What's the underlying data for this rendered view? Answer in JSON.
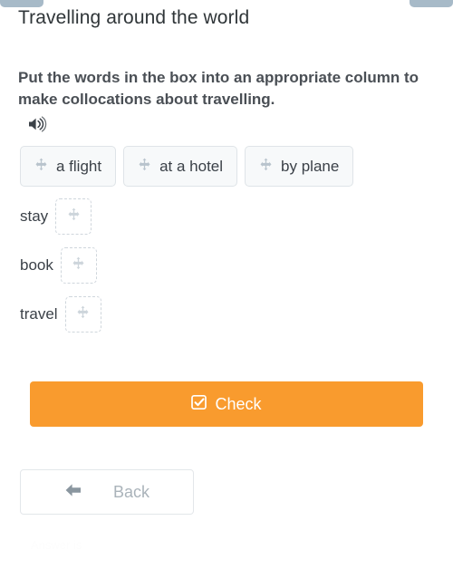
{
  "colors": {
    "accent_orange": "#f99b2e",
    "top_tab": "#a7bac8",
    "chip_bg": "#f7f9fa",
    "chip_border": "#dfe4e8",
    "drop_border": "#cfd6dc",
    "text_dark": "#3b4148",
    "text_muted": "#aab3ba"
  },
  "header": {
    "title": "Travelling around the world"
  },
  "task": {
    "instruction": "Put the words in the box into an appropriate column to make collocations about travelling.",
    "audio_icon": "volume-up-icon"
  },
  "word_bank": {
    "move_icon": "arrows-move-icon",
    "chips": [
      {
        "label": "a flight"
      },
      {
        "label": "at a hotel"
      },
      {
        "label": "by plane"
      }
    ]
  },
  "collocations": {
    "drop_icon": "arrows-move-icon",
    "rows": [
      {
        "label": "stay",
        "value": ""
      },
      {
        "label": "book",
        "value": ""
      },
      {
        "label": "travel",
        "value": ""
      }
    ]
  },
  "actions": {
    "check_label": "Check",
    "check_icon": "check-square-icon",
    "back_label": "Back",
    "back_icon": "arrow-left-icon"
  },
  "footer": {
    "ghost_text": "Answer is"
  }
}
